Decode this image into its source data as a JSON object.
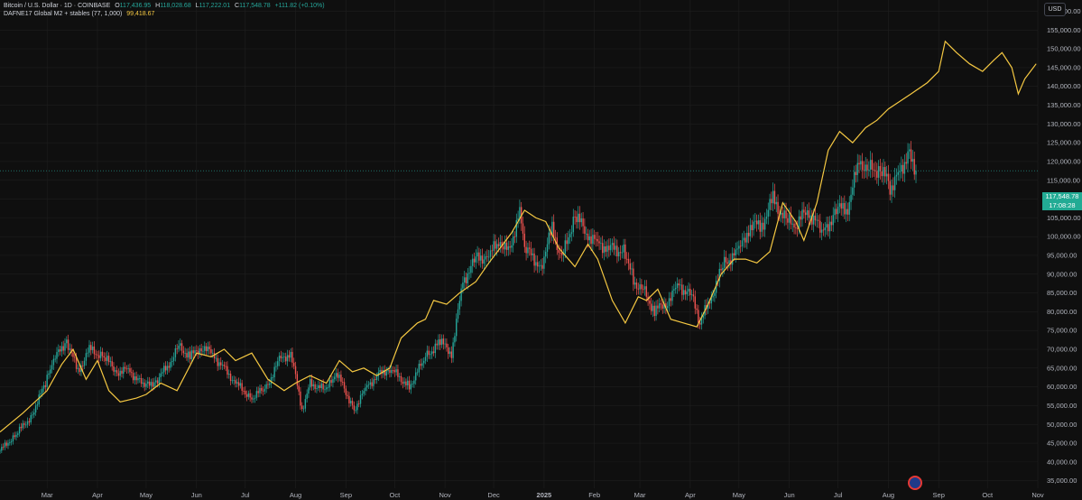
{
  "legend": {
    "symbol": "Bitcoin / U.S. Dollar · 1D · COINBASE",
    "o_label": "O",
    "o_value": "117,436.95",
    "h_label": "H",
    "h_value": "118,028.68",
    "l_label": "L",
    "l_value": "117,222.01",
    "c_label": "C",
    "c_value": "117,548.78",
    "change": "+111.82 (+0.10%)",
    "indicator_name": "DAFNE17 Global M2 + stables (77, 1,000)",
    "indicator_value": "99,418.67"
  },
  "currency_button": "USD",
  "price_tag": {
    "price": "117,548.78",
    "countdown": "17:08:28"
  },
  "colors": {
    "background": "#0f0f0f",
    "up": "#26a69a",
    "down": "#ef5350",
    "m2_line": "#f5c842",
    "grid": "#1f1f1f"
  },
  "icons": {
    "flag": "us-flag-icon"
  },
  "chart_data": {
    "type": "line",
    "title": "",
    "xlabel": "",
    "ylabel": "",
    "x_ticks": [
      "Mar",
      "Apr",
      "May",
      "Jun",
      "Jul",
      "Aug",
      "Sep",
      "Oct",
      "Nov",
      "Dec",
      "2025",
      "Feb",
      "Mar",
      "Apr",
      "May",
      "Jun",
      "Jul",
      "Aug",
      "Sep",
      "Oct",
      "Nov"
    ],
    "y_ticks": [
      "35,000.00",
      "40,000.00",
      "45,000.00",
      "50,000.00",
      "55,000.00",
      "60,000.00",
      "65,000.00",
      "70,000.00",
      "75,000.00",
      "80,000.00",
      "85,000.00",
      "90,000.00",
      "95,000.00",
      "100,000.00",
      "105,000.00",
      "110,000.00",
      "115,000.00",
      "120,000.00",
      "125,000.00",
      "130,000.00",
      "135,000.00",
      "140,000.00",
      "145,000.00",
      "150,000.00",
      "155,000.00",
      "160,000.00"
    ],
    "ylim": [
      33000,
      163000
    ],
    "xlim": [
      "2024-02-01",
      "2025-11-01"
    ],
    "grid": true,
    "series": [
      {
        "name": "Bitcoin / U.S. Dollar",
        "style": "candles",
        "points": [
          [
            "2024-02-01",
            43000
          ],
          [
            "2024-02-10",
            47000
          ],
          [
            "2024-02-20",
            52000
          ],
          [
            "2024-03-01",
            62000
          ],
          [
            "2024-03-05",
            67000
          ],
          [
            "2024-03-13",
            72500
          ],
          [
            "2024-03-20",
            64000
          ],
          [
            "2024-03-27",
            70000
          ],
          [
            "2024-04-05",
            68000
          ],
          [
            "2024-04-13",
            64000
          ],
          [
            "2024-04-20",
            64500
          ],
          [
            "2024-04-30",
            60000
          ],
          [
            "2024-05-08",
            62000
          ],
          [
            "2024-05-15",
            66000
          ],
          [
            "2024-05-21",
            71000
          ],
          [
            "2024-05-28",
            68000
          ],
          [
            "2024-06-05",
            71000
          ],
          [
            "2024-06-12",
            68000
          ],
          [
            "2024-06-18",
            65000
          ],
          [
            "2024-06-25",
            61000
          ],
          [
            "2024-07-05",
            57000
          ],
          [
            "2024-07-14",
            60000
          ],
          [
            "2024-07-22",
            67000
          ],
          [
            "2024-07-29",
            69000
          ],
          [
            "2024-08-05",
            54000
          ],
          [
            "2024-08-10",
            61000
          ],
          [
            "2024-08-20",
            59000
          ],
          [
            "2024-08-26",
            64000
          ],
          [
            "2024-09-06",
            54000
          ],
          [
            "2024-09-14",
            60000
          ],
          [
            "2024-09-20",
            63000
          ],
          [
            "2024-09-28",
            65000
          ],
          [
            "2024-10-10",
            60000
          ],
          [
            "2024-10-20",
            68000
          ],
          [
            "2024-10-29",
            72000
          ],
          [
            "2024-11-05",
            69000
          ],
          [
            "2024-11-12",
            88000
          ],
          [
            "2024-11-20",
            94000
          ],
          [
            "2024-11-28",
            95000
          ],
          [
            "2024-12-05",
            99000
          ],
          [
            "2024-12-10",
            96000
          ],
          [
            "2024-12-17",
            106000
          ],
          [
            "2024-12-20",
            97000
          ],
          [
            "2024-12-30",
            92000
          ],
          [
            "2025-01-06",
            102000
          ],
          [
            "2025-01-12",
            94000
          ],
          [
            "2025-01-20",
            106000
          ],
          [
            "2025-01-27",
            101000
          ],
          [
            "2025-02-03",
            98000
          ],
          [
            "2025-02-10",
            97000
          ],
          [
            "2025-02-20",
            96000
          ],
          [
            "2025-02-25",
            88000
          ],
          [
            "2025-03-03",
            86000
          ],
          [
            "2025-03-10",
            80000
          ],
          [
            "2025-03-18",
            83000
          ],
          [
            "2025-03-25",
            87000
          ],
          [
            "2025-04-02",
            84000
          ],
          [
            "2025-04-07",
            77000
          ],
          [
            "2025-04-14",
            84000
          ],
          [
            "2025-04-22",
            93000
          ],
          [
            "2025-05-01",
            96000
          ],
          [
            "2025-05-08",
            103000
          ],
          [
            "2025-05-15",
            103000
          ],
          [
            "2025-05-22",
            110000
          ],
          [
            "2025-05-30",
            104000
          ],
          [
            "2025-06-05",
            103000
          ],
          [
            "2025-06-12",
            107000
          ],
          [
            "2025-06-22",
            101000
          ],
          [
            "2025-06-30",
            107000
          ],
          [
            "2025-07-07",
            108000
          ],
          [
            "2025-07-14",
            120000
          ],
          [
            "2025-07-20",
            118000
          ],
          [
            "2025-07-28",
            118000
          ],
          [
            "2025-08-02",
            113000
          ],
          [
            "2025-08-08",
            117000
          ],
          [
            "2025-08-13",
            122000
          ],
          [
            "2025-08-18",
            117500
          ]
        ]
      },
      {
        "name": "DAFNE17 Global M2 + stables (77, 1,000)",
        "style": "line",
        "points": [
          [
            "2024-02-01",
            48000
          ],
          [
            "2024-02-15",
            53000
          ],
          [
            "2024-03-01",
            59000
          ],
          [
            "2024-03-10",
            66000
          ],
          [
            "2024-03-17",
            70000
          ],
          [
            "2024-03-25",
            62000
          ],
          [
            "2024-04-01",
            67000
          ],
          [
            "2024-04-08",
            59000
          ],
          [
            "2024-04-15",
            56000
          ],
          [
            "2024-04-25",
            57000
          ],
          [
            "2024-05-01",
            58000
          ],
          [
            "2024-05-10",
            61000
          ],
          [
            "2024-05-20",
            59000
          ],
          [
            "2024-06-01",
            69000
          ],
          [
            "2024-06-10",
            68000
          ],
          [
            "2024-06-18",
            70000
          ],
          [
            "2024-06-25",
            67000
          ],
          [
            "2024-07-05",
            69000
          ],
          [
            "2024-07-15",
            62000
          ],
          [
            "2024-07-25",
            59000
          ],
          [
            "2024-08-01",
            61000
          ],
          [
            "2024-08-10",
            63000
          ],
          [
            "2024-08-20",
            61000
          ],
          [
            "2024-08-28",
            67000
          ],
          [
            "2024-09-05",
            64000
          ],
          [
            "2024-09-12",
            65000
          ],
          [
            "2024-09-20",
            63000
          ],
          [
            "2024-09-28",
            65000
          ],
          [
            "2024-10-05",
            73000
          ],
          [
            "2024-10-15",
            77000
          ],
          [
            "2024-10-20",
            78000
          ],
          [
            "2024-10-25",
            83000
          ],
          [
            "2024-11-02",
            82000
          ],
          [
            "2024-11-10",
            85000
          ],
          [
            "2024-11-20",
            88000
          ],
          [
            "2024-11-28",
            93000
          ],
          [
            "2024-12-05",
            97000
          ],
          [
            "2024-12-12",
            101000
          ],
          [
            "2024-12-20",
            107000
          ],
          [
            "2024-12-27",
            105000
          ],
          [
            "2025-01-02",
            104000
          ],
          [
            "2025-01-10",
            97000
          ],
          [
            "2025-01-20",
            92000
          ],
          [
            "2025-01-28",
            98000
          ],
          [
            "2025-02-03",
            94000
          ],
          [
            "2025-02-12",
            83000
          ],
          [
            "2025-02-20",
            77000
          ],
          [
            "2025-02-28",
            84000
          ],
          [
            "2025-03-05",
            83000
          ],
          [
            "2025-03-12",
            86000
          ],
          [
            "2025-03-20",
            78000
          ],
          [
            "2025-03-28",
            77000
          ],
          [
            "2025-04-05",
            76000
          ],
          [
            "2025-04-12",
            82000
          ],
          [
            "2025-04-20",
            90000
          ],
          [
            "2025-04-28",
            94000
          ],
          [
            "2025-05-05",
            94000
          ],
          [
            "2025-05-12",
            93000
          ],
          [
            "2025-05-20",
            96000
          ],
          [
            "2025-05-28",
            109000
          ],
          [
            "2025-06-05",
            104000
          ],
          [
            "2025-06-10",
            99000
          ],
          [
            "2025-06-18",
            109000
          ],
          [
            "2025-06-25",
            123000
          ],
          [
            "2025-07-02",
            128000
          ],
          [
            "2025-07-10",
            125000
          ],
          [
            "2025-07-18",
            129000
          ],
          [
            "2025-07-25",
            131000
          ],
          [
            "2025-08-01",
            134000
          ],
          [
            "2025-08-08",
            136000
          ],
          [
            "2025-08-15",
            138000
          ],
          [
            "2025-08-25",
            141000
          ],
          [
            "2025-09-01",
            144000
          ],
          [
            "2025-09-05",
            152000
          ],
          [
            "2025-09-12",
            149000
          ],
          [
            "2025-09-20",
            146000
          ],
          [
            "2025-09-28",
            144000
          ],
          [
            "2025-10-05",
            147000
          ],
          [
            "2025-10-10",
            149000
          ],
          [
            "2025-10-16",
            145000
          ],
          [
            "2025-10-20",
            138000
          ],
          [
            "2025-10-24",
            142000
          ],
          [
            "2025-10-31",
            146000
          ]
        ]
      }
    ]
  }
}
